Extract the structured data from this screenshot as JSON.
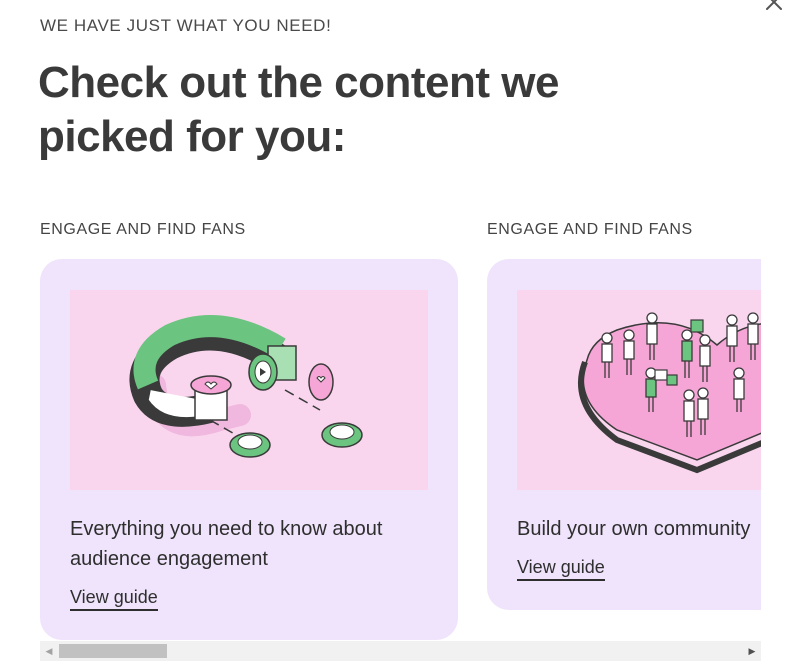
{
  "header": {
    "eyebrow": "WE HAVE JUST WHAT YOU NEED!",
    "headline": "Check out the content we picked for you:",
    "close_icon": "close-icon"
  },
  "cards": [
    {
      "category": "ENGAGE AND FIND FANS",
      "title": "Everything you need to know about audience engagement",
      "link": "View guide",
      "illustration": "magnet-illustration"
    },
    {
      "category": "ENGAGE AND FIND FANS",
      "title": "Build your own community",
      "link": "View guide",
      "illustration": "community-heart-illustration"
    }
  ],
  "colors": {
    "card_bg": "#efe4fb",
    "illus_bg": "#f9d6ee",
    "accent_green": "#6bc47f",
    "accent_pink": "#f5a6d6",
    "text": "#3a3a3a"
  },
  "scrollbar": {
    "left_arrow": "scroll-left-icon",
    "right_arrow": "scroll-right-icon"
  }
}
